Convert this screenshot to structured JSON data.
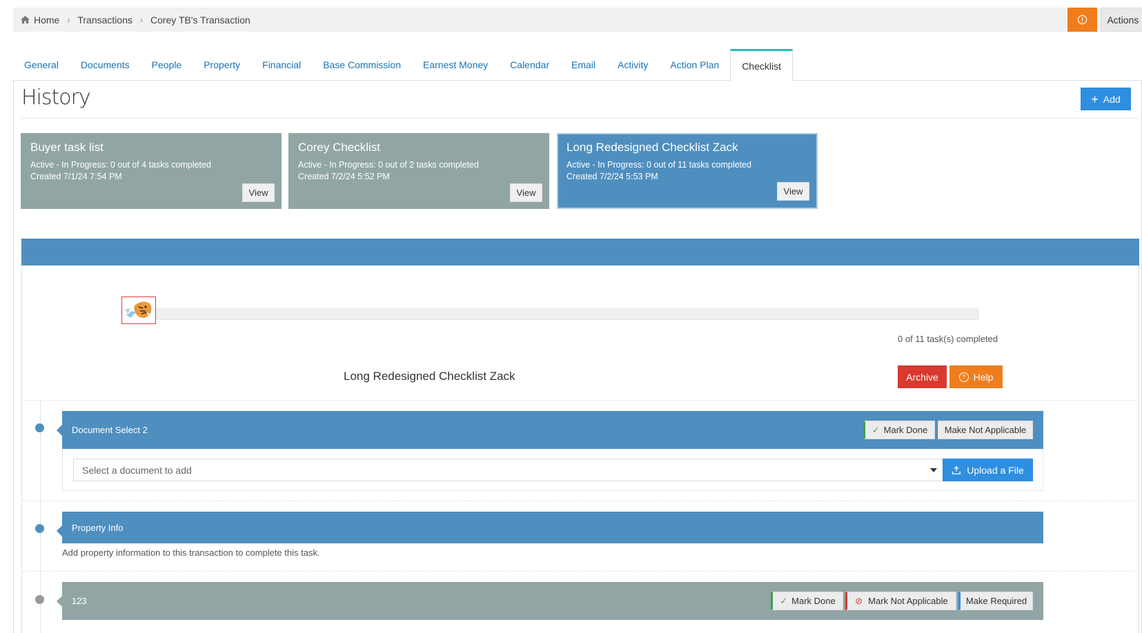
{
  "breadcrumb": {
    "items": [
      "Home",
      "Transactions",
      "Corey TB's Transaction"
    ]
  },
  "topbar": {
    "actions_label": "Actions"
  },
  "tabs": [
    {
      "label": "General"
    },
    {
      "label": "Documents"
    },
    {
      "label": "People"
    },
    {
      "label": "Property"
    },
    {
      "label": "Financial"
    },
    {
      "label": "Base Commission"
    },
    {
      "label": "Earnest Money"
    },
    {
      "label": "Calendar"
    },
    {
      "label": "Email"
    },
    {
      "label": "Activity"
    },
    {
      "label": "Action Plan"
    },
    {
      "label": "Checklist",
      "active": true
    }
  ],
  "history": {
    "title": "History",
    "add_label": "Add"
  },
  "cards": [
    {
      "title": "Buyer task list",
      "status": "Active - In Progress: 0 out of 4 tasks completed",
      "created": "Created 7/1/24 7:54 PM",
      "view_label": "View"
    },
    {
      "title": "Corey Checklist",
      "status": "Active - In Progress: 0 out of 2 tasks completed",
      "created": "Created 7/2/24 5:52 PM",
      "view_label": "View"
    },
    {
      "title": "Long Redesigned Checklist Zack",
      "status": "Active - In Progress: 0 out of 11 tasks completed",
      "created": "Created 7/2/24 5:53 PM",
      "view_label": "View",
      "selected": true
    }
  ],
  "checklist": {
    "progress_text": "0 of 11 task(s) completed",
    "progress_fraction": 0,
    "name": "Long Redesigned Checklist Zack",
    "archive_label": "Archive",
    "help_label": "Help"
  },
  "tasks": [
    {
      "title": "Document Select 2",
      "mark_done_label": "Mark Done",
      "not_applicable_label": "Make Not Applicable",
      "select_placeholder": "Select a document to add",
      "upload_label": "Upload a File"
    },
    {
      "title": "Property Info",
      "description": "Add property information to this transaction to complete this task."
    },
    {
      "title": "123",
      "mark_done_label": "Mark Done",
      "not_applicable_label": "Mark Not Applicable",
      "make_required_label": "Make Required"
    }
  ],
  "colors": {
    "primary_blue": "#4f8fbf",
    "accent_orange": "#f07d1c",
    "danger_red": "#d9392f",
    "card_grey": "#92a5a5",
    "link_blue": "#1a73b5",
    "tab_active_border": "#2bbcb8"
  }
}
